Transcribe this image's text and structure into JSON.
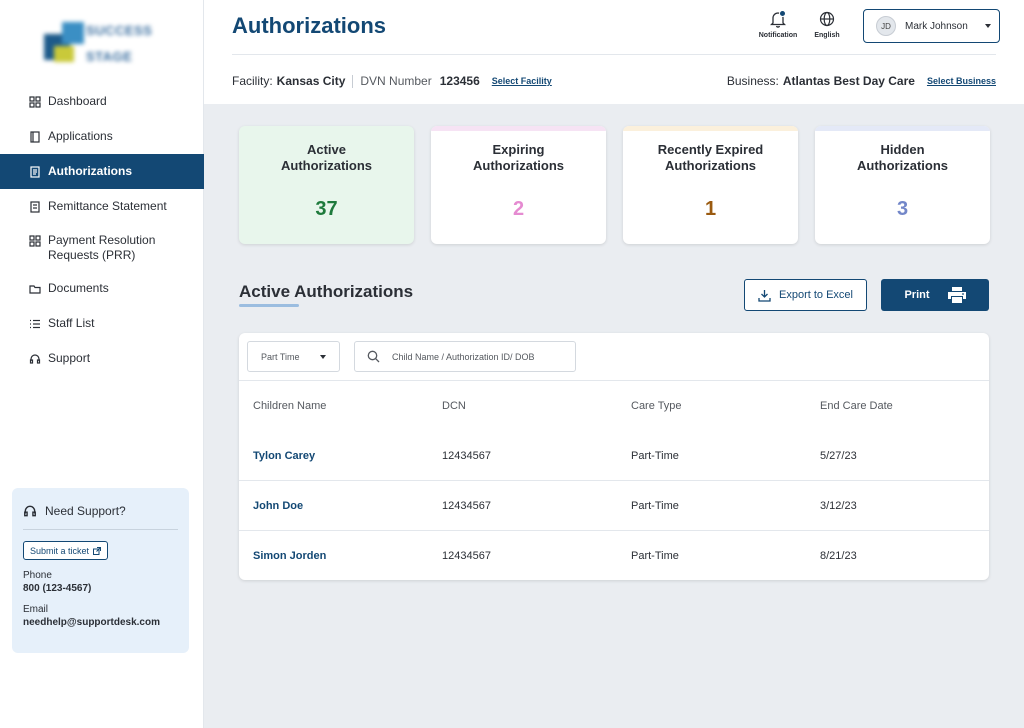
{
  "logo": {
    "text_line1": "SUCCESS",
    "text_line2": "STAGE"
  },
  "sidebar": {
    "items": [
      {
        "label": "Dashboard",
        "icon": "grid-icon"
      },
      {
        "label": "Applications",
        "icon": "book-icon"
      },
      {
        "label": "Authorizations",
        "icon": "document-icon",
        "active": true
      },
      {
        "label": "Remittance Statement",
        "icon": "receipt-icon"
      },
      {
        "label": "Payment Resolution Requests (PRR)",
        "icon": "grid-icon"
      },
      {
        "label": "Documents",
        "icon": "folder-icon"
      },
      {
        "label": "Staff List",
        "icon": "list-icon"
      },
      {
        "label": "Support",
        "icon": "headset-icon"
      }
    ],
    "support": {
      "title": "Need Support?",
      "ticket_label": "Submit a ticket",
      "phone_label": "Phone",
      "phone": "800 (123-4567)",
      "email_label": "Email",
      "email": "needhelp@supportdesk.com"
    }
  },
  "header": {
    "title": "Authorizations",
    "notification_label": "Notification",
    "language_label": "English",
    "user_initials": "JD",
    "user_name": "Mark Johnson"
  },
  "facility": {
    "facility_label": "Facility:",
    "facility_value": "Kansas City",
    "dvn_label": "DVN Number",
    "dvn_value": "123456",
    "select_facility": "Select Facility",
    "business_label": "Business:",
    "business_value": "Atlantas Best Day Care",
    "select_business": "Select Business"
  },
  "cards": [
    {
      "title_line1": "Active",
      "title_line2": "Authorizations",
      "count": "37",
      "color": "#1e7a3c",
      "bar": "#e8f6ec"
    },
    {
      "title_line1": "Expiring",
      "title_line2": "Authorizations",
      "count": "2",
      "color": "#e58bd1",
      "bar": "#f6e3f4"
    },
    {
      "title_line1": "Recently Expired",
      "title_line2": "Authorizations",
      "count": "1",
      "color": "#9a5a10",
      "bar": "#fbf0dc"
    },
    {
      "title_line1": "Hidden",
      "title_line2": "Authorizations",
      "count": "3",
      "color": "#7387c9",
      "bar": "#e4e9f7"
    }
  ],
  "section": {
    "title": "Active Authorizations",
    "export_label": "Export to Excel",
    "print_label": "Print"
  },
  "table": {
    "filter_value": "Part Time",
    "search_placeholder": "Child Name / Authorization ID/ DOB",
    "headers": [
      "Children Name",
      "DCN",
      "Care Type",
      "End Care Date"
    ],
    "rows": [
      [
        "Tylon Carey",
        "12434567",
        "Part-Time",
        "5/27/23"
      ],
      [
        "John Doe",
        "12434567",
        "Part-Time",
        "3/12/23"
      ],
      [
        "Simon Jorden",
        "12434567",
        "Part-Time",
        "8/21/23"
      ]
    ]
  }
}
